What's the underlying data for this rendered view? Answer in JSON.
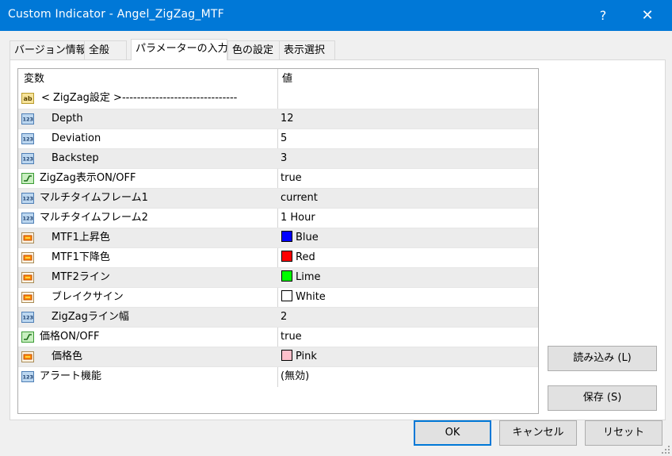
{
  "window": {
    "title": "Custom Indicator - Angel_ZigZag_MTF",
    "help_label": "?",
    "close_label": "✕"
  },
  "tabs": [
    {
      "label": "バージョン情報"
    },
    {
      "label": "全般"
    },
    {
      "label": "パラメーターの入力"
    },
    {
      "label": "色の設定"
    },
    {
      "label": "表示選択"
    }
  ],
  "grid": {
    "header_variable": "変数",
    "header_value": "値",
    "rows": [
      {
        "icon": "ab-string-icon",
        "name": "< ZigZag設定 >-------------------------------",
        "value": ""
      },
      {
        "icon": "int-123-icon",
        "name": "Depth",
        "value": "12"
      },
      {
        "icon": "int-123-icon",
        "name": "Deviation",
        "value": "5"
      },
      {
        "icon": "int-123-icon",
        "name": "Backstep",
        "value": "3"
      },
      {
        "icon": "bool-toggle-icon",
        "name": "ZigZag表示ON/OFF",
        "value": "true"
      },
      {
        "icon": "int-123-icon",
        "name": "マルチタイムフレーム1",
        "value": "current"
      },
      {
        "icon": "int-123-icon",
        "name": "マルチタイムフレーム2",
        "value": "1 Hour"
      },
      {
        "icon": "color-icon",
        "name": "MTF1上昇色",
        "value": "Blue",
        "swatch": "#0000ff"
      },
      {
        "icon": "color-icon",
        "name": "MTF1下降色",
        "value": "Red",
        "swatch": "#ff0000"
      },
      {
        "icon": "color-icon",
        "name": "MTF2ライン",
        "value": "Lime",
        "swatch": "#00ff00"
      },
      {
        "icon": "color-icon",
        "name": "ブレイクサイン",
        "value": "White",
        "swatch": "#ffffff"
      },
      {
        "icon": "int-123-icon",
        "name": "ZigZagライン幅",
        "value": "2"
      },
      {
        "icon": "bool-toggle-icon",
        "name": "価格ON/OFF",
        "value": "true"
      },
      {
        "icon": "color-icon",
        "name": "価格色",
        "value": "Pink",
        "swatch": "#ffc0cb"
      },
      {
        "icon": "int-123-icon",
        "name": "アラート機能",
        "value": "(無効)"
      }
    ]
  },
  "buttons": {
    "load": "読み込み (L)",
    "save": "保存 (S)",
    "ok": "OK",
    "cancel": "キャンセル",
    "reset": "リセット"
  }
}
